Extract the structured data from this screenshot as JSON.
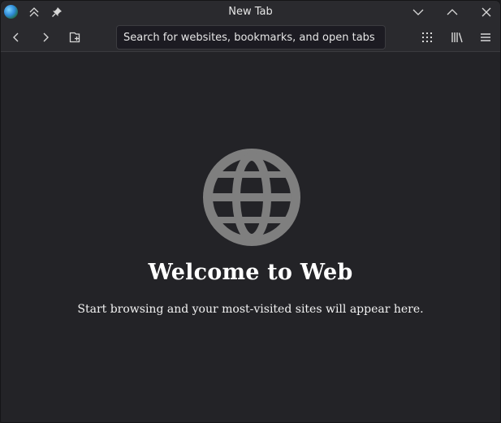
{
  "window": {
    "title": "New Tab",
    "app_icon": "globe-app-icon",
    "controls": [
      "minimize-icon",
      "maximize-icon",
      "close-icon"
    ],
    "left_controls": [
      "keep-above-icon",
      "pin-icon"
    ]
  },
  "toolbar": {
    "back_icon": "chevron-left-icon",
    "forward_icon": "chevron-right-icon",
    "new_tab_icon": "new-tab-icon",
    "url_placeholder": "Search for websites, bookmarks, and open tabs",
    "url_value": "",
    "right_icons": [
      "grid-icon",
      "library-icon",
      "hamburger-menu-icon"
    ]
  },
  "main": {
    "heading": "Welcome to Web",
    "subtitle": "Start browsing and your most-visited sites will appear here.",
    "illustration": "globe-icon"
  },
  "colors": {
    "background": "#232327",
    "toolbar": "#2a2a2e",
    "globe": "#7f7f7f",
    "text": "#ffffff"
  }
}
